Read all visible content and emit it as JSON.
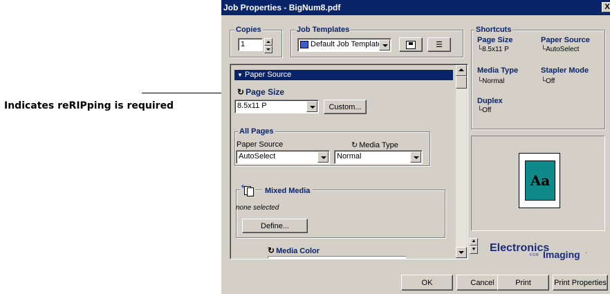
{
  "callout": {
    "text": "Indicates reRIPping is required"
  },
  "dialog": {
    "title": "Job Properties - BigNum8.pdf",
    "close": "X"
  },
  "copies": {
    "legend": "Copies",
    "value": "1"
  },
  "job_templates": {
    "legend": "Job Templates",
    "selected": "Default Job Templates"
  },
  "panel": {
    "section_header": "Paper Source",
    "page_size": {
      "label": "Page Size",
      "value": "8.5x11 P",
      "custom_button": "Custom..."
    },
    "all_pages": {
      "legend": "All Pages",
      "paper_source_label": "Paper Source",
      "paper_source_value": "AutoSelect",
      "media_type_label": "Media Type",
      "media_type_value": "Normal"
    },
    "mixed_media": {
      "label": "Mixed Media",
      "status": "none selected",
      "define_button": "Define..."
    },
    "media_color": {
      "label": "Media Color"
    }
  },
  "shortcuts": {
    "legend": "Shortcuts",
    "items": [
      {
        "title": "Page Size",
        "value": "8.5x11 P"
      },
      {
        "title": "Paper Source",
        "value": "AutoSelect"
      },
      {
        "title": "Media Type",
        "value": "Normal"
      },
      {
        "title": "Stapler Mode",
        "value": "Off"
      },
      {
        "title": "Duplex",
        "value": "Off"
      }
    ]
  },
  "preview": {
    "text": "Aa"
  },
  "logo": {
    "line1": "Electronics",
    "for": "FOR",
    "line2": "Imaging",
    "mark": "·"
  },
  "buttons": {
    "ok": "OK",
    "cancel": "Cancel",
    "print": "Print",
    "print_properties": "Print Properties"
  },
  "colors": {
    "title_bar": "#0a246a",
    "dialog_bg": "#d4d0c8",
    "preview_fill": "#0f8a8a",
    "label_blue": "#0a246a"
  }
}
